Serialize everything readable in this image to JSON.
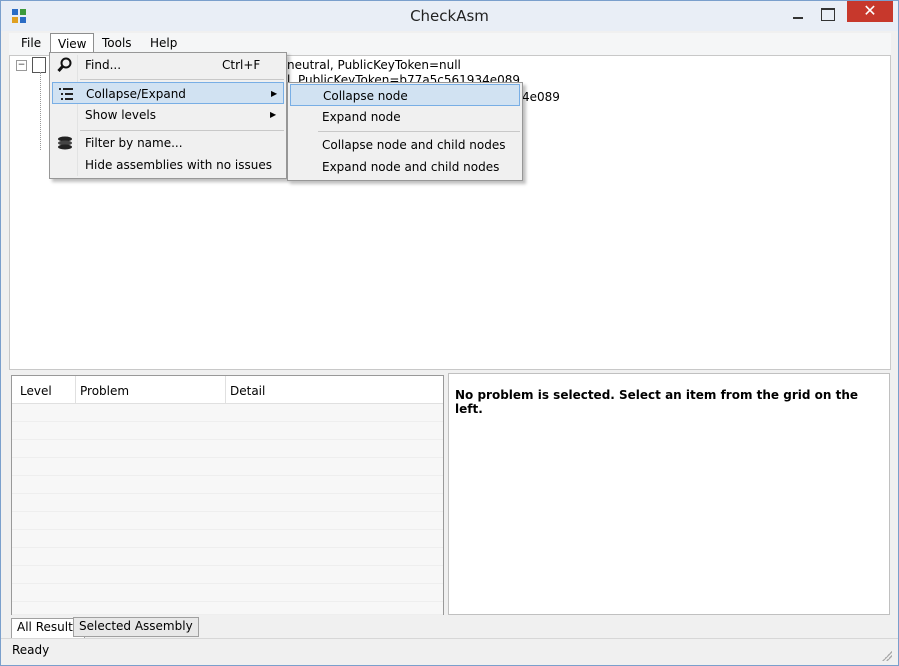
{
  "window": {
    "title": "CheckAsm",
    "close_glyph": "✕"
  },
  "menubar": {
    "file": "File",
    "view": "View",
    "tools": "Tools",
    "help": "Help"
  },
  "tree": {
    "expander_glyph": "−",
    "line1": "neutral, PublicKeyToken=null",
    "line2": "l, PublicKeyToken=b77a5c561934e089",
    "line3": "4e089"
  },
  "view_menu": {
    "find": "Find...",
    "find_shortcut": "Ctrl+F",
    "collapse_expand": "Collapse/Expand",
    "show_levels": "Show levels",
    "filter_by_name": "Filter by name...",
    "hide_assemblies": "Hide assemblies with no issues"
  },
  "collapse_submenu": {
    "collapse_node": "Collapse node",
    "expand_node": "Expand node",
    "collapse_node_children": "Collapse node and child nodes",
    "expand_node_children": "Expand node and child nodes"
  },
  "grid": {
    "columns": [
      "Level",
      "Problem",
      "Detail"
    ]
  },
  "detail": {
    "message": "No problem is selected. Select an item from the grid on the left."
  },
  "tabs": {
    "all_results": "All Results",
    "selected_assembly": "Selected Assembly"
  },
  "status": {
    "text": "Ready"
  },
  "colors": {
    "close_button": "#c7382c",
    "highlight": "#d1e2f2",
    "highlight_border": "#78aee5"
  }
}
